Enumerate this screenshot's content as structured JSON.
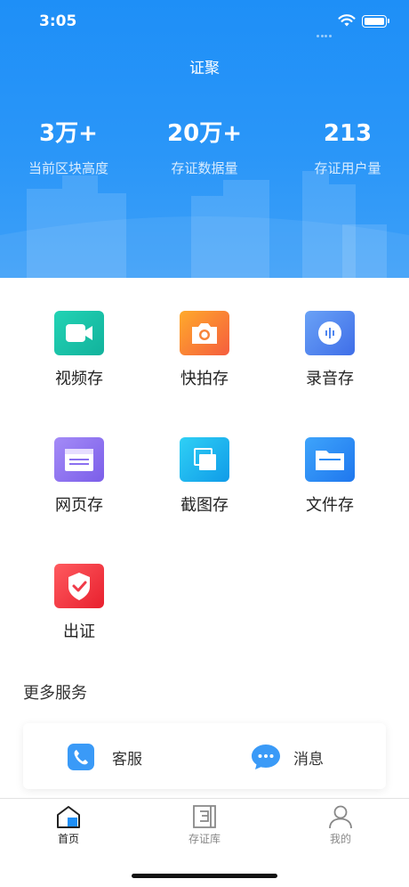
{
  "status_bar": {
    "time": "3:05"
  },
  "header": {
    "title": "证聚"
  },
  "stats": [
    {
      "value": "3万+",
      "label": "当前区块高度"
    },
    {
      "value": "20万+",
      "label": "存证数据量"
    },
    {
      "value": "213",
      "label": "存证用户量"
    }
  ],
  "features": [
    {
      "label": "视频存",
      "icon": "video-camera-icon",
      "color": "#17c2a8"
    },
    {
      "label": "快拍存",
      "icon": "camera-icon",
      "color": "#f57b3a"
    },
    {
      "label": "录音存",
      "icon": "audio-icon",
      "color": "#4f86f0"
    },
    {
      "label": "网页存",
      "icon": "webpage-icon",
      "color": "#8a6ff0"
    },
    {
      "label": "截图存",
      "icon": "screenshot-icon",
      "color": "#14b4ee"
    },
    {
      "label": "文件存",
      "icon": "folder-icon",
      "color": "#2b8cf6"
    },
    {
      "label": "出证",
      "icon": "shield-check-icon",
      "color": "#f03a48"
    }
  ],
  "more_services": {
    "title": "更多服务",
    "items": [
      {
        "label": "客服",
        "icon": "phone-icon"
      },
      {
        "label": "消息",
        "icon": "chat-bubble-icon"
      }
    ]
  },
  "tabbar": {
    "items": [
      {
        "label": "首页",
        "icon": "home-icon",
        "active": true
      },
      {
        "label": "存证库",
        "icon": "library-icon",
        "active": false
      },
      {
        "label": "我的",
        "icon": "user-icon",
        "active": false
      }
    ]
  }
}
